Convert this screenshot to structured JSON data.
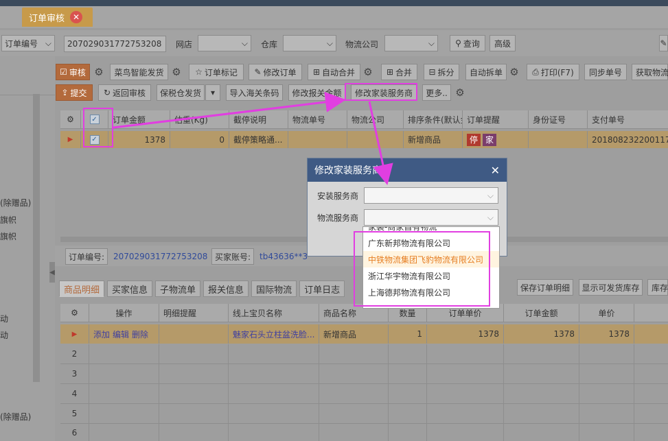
{
  "tab": {
    "label": "订单审核",
    "close": "✕"
  },
  "filter": {
    "field_select": "订单编号",
    "order_no_value": "207029031772753208",
    "shop_label": "网店",
    "warehouse_label": "仓库",
    "logistics_label": "物流公司",
    "search_button": "查询",
    "advanced_button": "高级"
  },
  "toolbar1": {
    "audit": "审核",
    "cainiao": "菜鸟智能发货",
    "order_mark": "订单标记",
    "modify_order": "修改订单",
    "auto_merge": "自动合并",
    "merge": "合并",
    "split": "拆分",
    "auto_split": "自动拆单",
    "print": "打印(F7)",
    "sync_no": "同步单号",
    "get_logistics": "获取物流"
  },
  "toolbar2": {
    "submit": "提交",
    "return_audit": "返回审核",
    "bonded_ship": "保税仓发货",
    "import_customs": "导入海关条码",
    "modify_customs_amount": "修改报关金额",
    "modify_install_provider": "修改家装服务商",
    "more": "更多.."
  },
  "order_grid": {
    "headers": [
      "订单金额",
      "估重(Kg)",
      "截停说明",
      "物流单号",
      "物流公司",
      "排序条件(默认金",
      "订单提醒",
      "身份证号",
      "支付单号"
    ],
    "row": {
      "amount": "1378",
      "weight": "0",
      "stop_note": "截停策略通...",
      "logistics_no": "",
      "logistics_co": "",
      "sort": "新增商品",
      "tag1": "停",
      "tag2": "家",
      "id_no": "",
      "pay_no": "201808232200117692"
    }
  },
  "left_panel": {
    "items": [
      "(除赠品)",
      "旗帜",
      "旗帜",
      "动",
      "动",
      "(除赠品)"
    ]
  },
  "detail": {
    "order_no_label": "订单编号:",
    "order_no_value": "207029031772753208",
    "buyer_label": "买家账号:",
    "buyer_value": "tb43636**3"
  },
  "detail_tabs": [
    "商品明细",
    "买家信息",
    "子物流单",
    "报关信息",
    "国际物流",
    "订单日志"
  ],
  "detail_buttons": {
    "save": "保存订单明细",
    "show_stock": "显示可发货库存",
    "stock": "库存"
  },
  "items_grid": {
    "headers": [
      "操作",
      "明细提醒",
      "线上宝贝名称",
      "商品名称",
      "数量",
      "订单单价",
      "订单金额",
      "单价"
    ],
    "row": {
      "add": "添加",
      "edit": "编辑",
      "delete": "删除",
      "online_name": "魅家石头立柱盆洗脸...",
      "goods_name": "新增商品",
      "qty": "1",
      "price": "1378",
      "amount": "1378",
      "unit": "1378"
    },
    "row_numbers": [
      "2",
      "3",
      "4",
      "5",
      "6"
    ]
  },
  "dialog": {
    "title": "修改家装服务商",
    "close": "✕",
    "install_label": "安装服务商",
    "logistics_label": "物流服务商"
  },
  "dropdown": {
    "options": [
      "家装-商家自有物流",
      "广东新邦物流有限公司",
      "中铁物流集团飞豹物流有限公司",
      "浙江华宇物流有限公司",
      "上海德邦物流有限公司"
    ]
  },
  "colors": {
    "accent": "#b36a3c",
    "annotation": "#e13ee1",
    "dialog_header": "#3f5a84"
  }
}
